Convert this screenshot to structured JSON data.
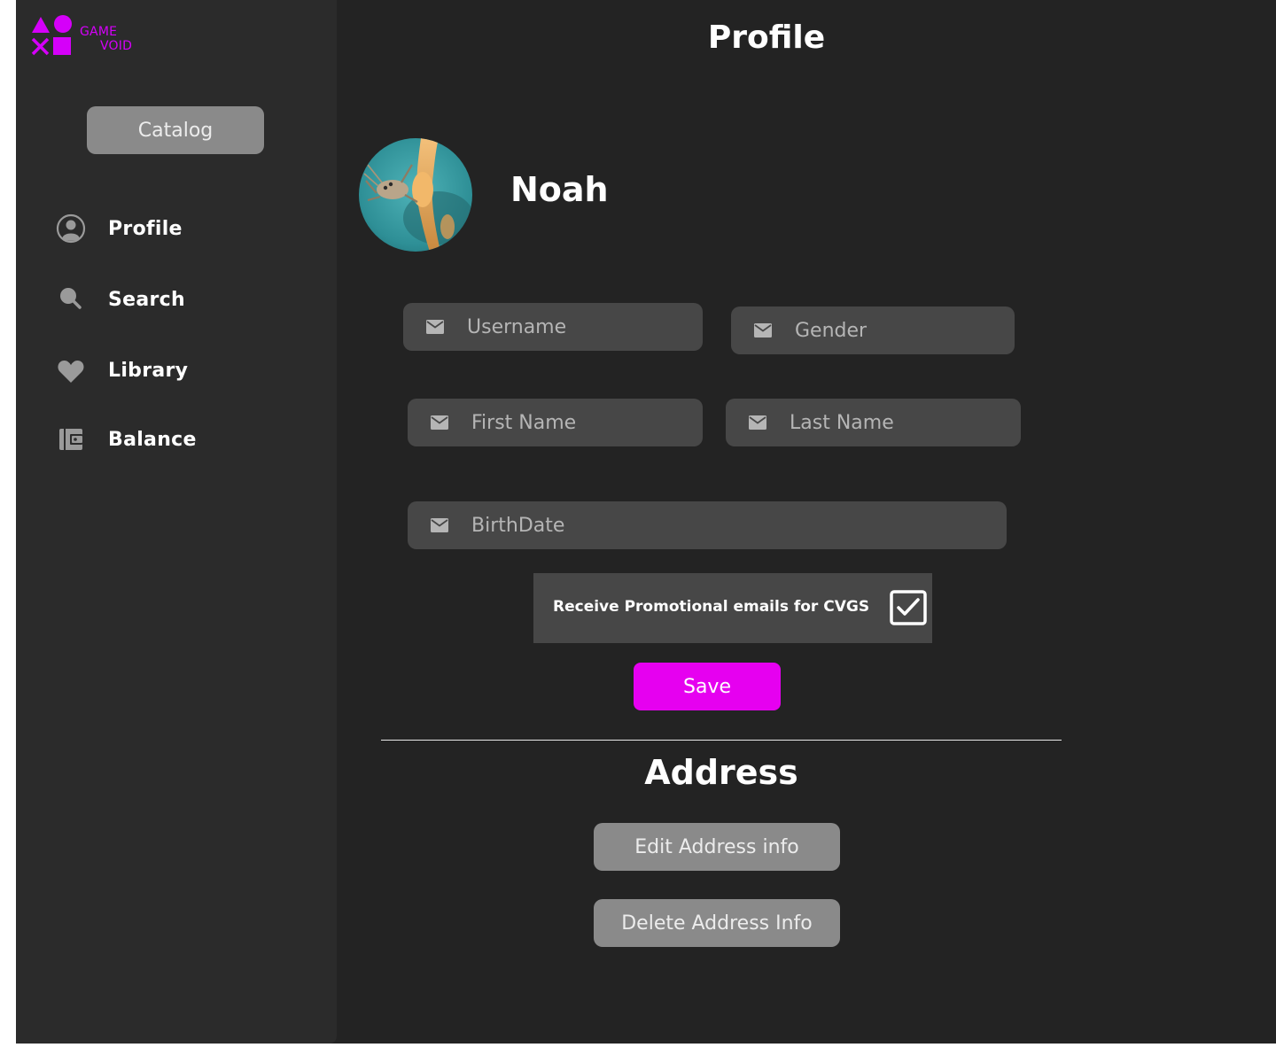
{
  "brand": {
    "line1": "GAME",
    "line2": "VOID",
    "accent_color": "#d500f9"
  },
  "sidebar": {
    "catalog_label": "Catalog",
    "items": [
      {
        "label": "Profile",
        "icon": "user-circle-icon"
      },
      {
        "label": "Search",
        "icon": "search-icon"
      },
      {
        "label": "Library",
        "icon": "heart-icon"
      },
      {
        "label": "Balance",
        "icon": "wallet-icon"
      }
    ]
  },
  "header": {
    "title": "Profile"
  },
  "profile": {
    "name": "Noah",
    "avatar_icon": "avatar-photo"
  },
  "form": {
    "username_placeholder": "Username",
    "gender_placeholder": "Gender",
    "first_name_placeholder": "First Name",
    "last_name_placeholder": "Last Name",
    "birthdate_placeholder": "BirthDate",
    "field_icon": "mail-icon",
    "promo_label": "Receive Promotional emails for CVGS",
    "promo_checked": true,
    "save_label": "Save",
    "save_color": "#e600f0"
  },
  "address": {
    "title": "Address",
    "edit_label": "Edit Address info",
    "delete_label": "Delete Address Info"
  }
}
